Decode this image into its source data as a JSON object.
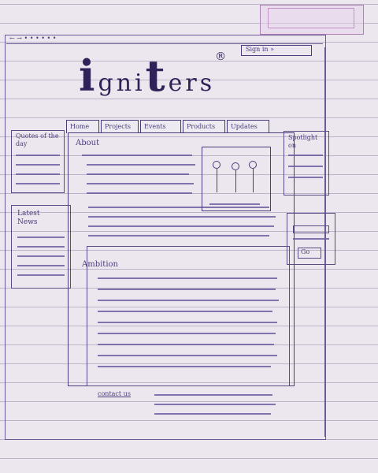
{
  "browser": {
    "address_text": "← → • • • • • •"
  },
  "header": {
    "logo_text": {
      "part1": "i",
      "part2": "gni",
      "part3": "t",
      "part4": "ers",
      "reg": "®"
    },
    "signup_label": "Sign in »"
  },
  "nav": {
    "tabs": [
      "Home",
      "Projects",
      "Events",
      "Products",
      "Updates"
    ]
  },
  "main": {
    "about_label": "About",
    "ambition_label": "Ambition",
    "footer_label": "contact us"
  },
  "left_sidebar": {
    "box1_label": "Quotes of the day",
    "box2_label": "Latest News"
  },
  "right_sidebar": {
    "box1_label": "Spotlight on",
    "go_label": "Go"
  },
  "colors": {
    "ink": "#4b3b7a",
    "paper": "#ece7ef",
    "highlighter": "#b07fb5"
  }
}
